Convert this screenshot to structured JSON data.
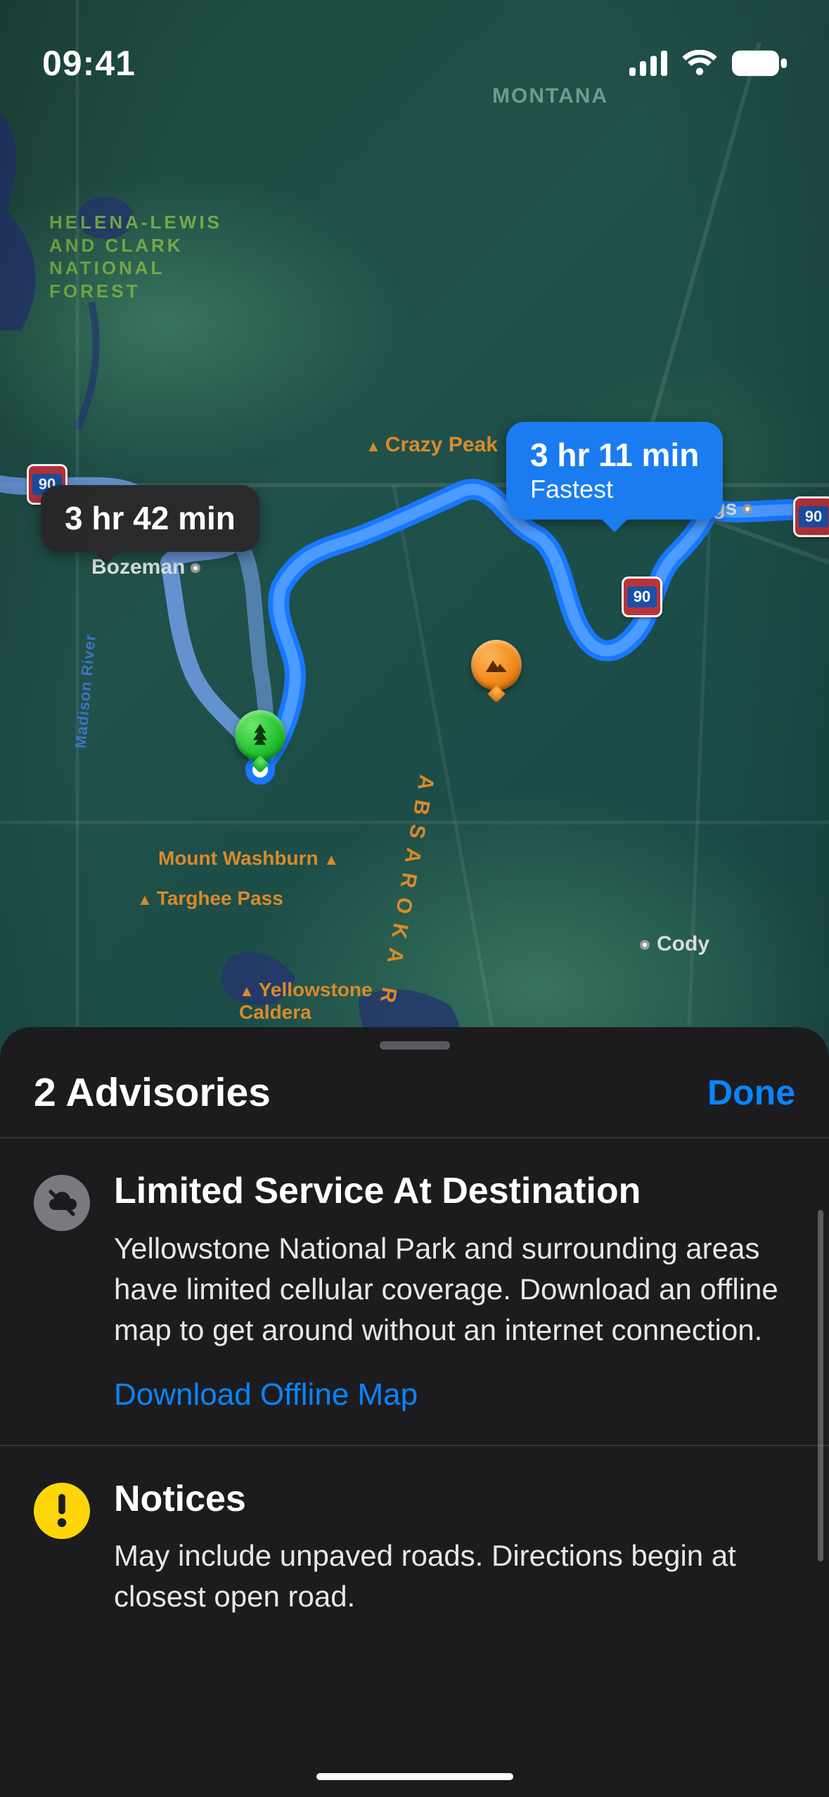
{
  "status_bar": {
    "time": "09:41"
  },
  "map": {
    "region_montana": "MONTANA",
    "forest_helena": "HELENA-LEWIS\nAND CLARK\nNATIONAL\nFOREST",
    "peak_crazy": "Crazy Peak",
    "city_bozeman": "Bozeman",
    "city_billings": "Billings",
    "city_cody": "Cody",
    "peak_washburn": "Mount Washburn",
    "peak_targhee": "Targhee Pass",
    "peak_caldera": "Yellowstone\nCaldera",
    "range_absaroka": "ABSAROKA R",
    "river_madison": "Madison River",
    "hwy_90": "90"
  },
  "routes": {
    "primary": {
      "time": "3 hr 11 min",
      "sub": "Fastest"
    },
    "secondary": {
      "time": "3 hr 42 min"
    }
  },
  "sheet": {
    "title": "2 Advisories",
    "done": "Done",
    "limited": {
      "title": "Limited Service At Destination",
      "body": "Yellowstone National Park and surrounding areas have limited cellular coverage. Download an offline map to get around without an internet connection.",
      "link": "Download Offline Map"
    },
    "notices": {
      "title": "Notices",
      "body": "May include unpaved roads. Directions begin at closest open road."
    }
  }
}
